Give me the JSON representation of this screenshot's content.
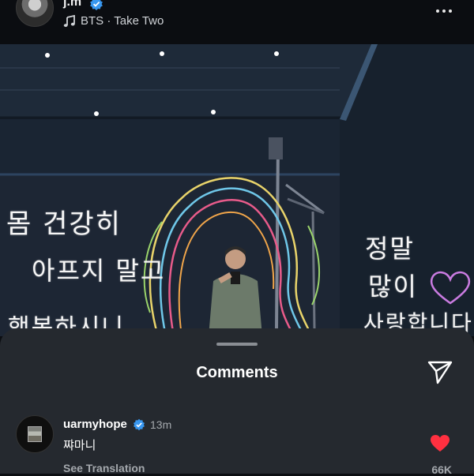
{
  "header": {
    "username": "j.m",
    "music": "BTS · Take Two"
  },
  "photo": {
    "handwriting_left": [
      "몸 건강히",
      "아프지 말고",
      "행복하시니"
    ],
    "handwriting_right": [
      "정말",
      "많이",
      "사랑합니다"
    ]
  },
  "comments": {
    "title": "Comments",
    "items": [
      {
        "user": "uarmyhope",
        "time": "13m",
        "text": "쨔마니",
        "translate_label": "See Translation",
        "like_count": "66K"
      }
    ]
  },
  "colors": {
    "accent_like": "#ff3040",
    "verified": "#3897f0"
  }
}
